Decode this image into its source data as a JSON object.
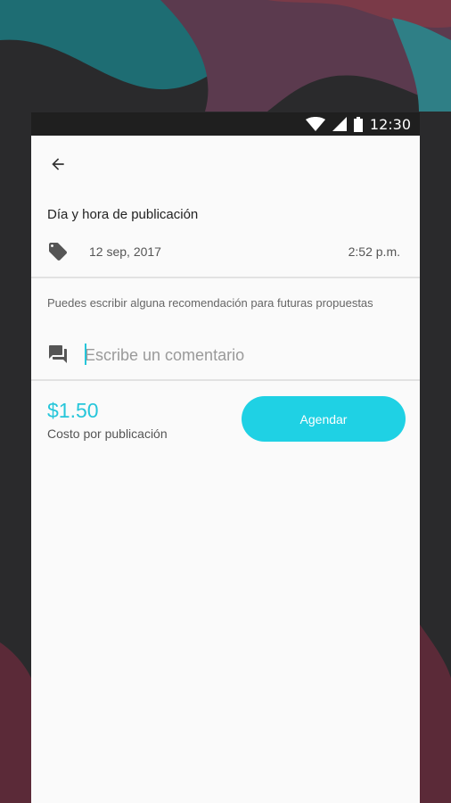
{
  "status_bar": {
    "time": "12:30"
  },
  "app_bar": {
    "back_icon": "arrow-left-icon",
    "title": ""
  },
  "schedule": {
    "title": "Día y hora de publicación",
    "date_icon": "tag-icon",
    "date": "12 sep, 2017",
    "time": "2:52 p.m."
  },
  "comment": {
    "hint": "Puedes escribir alguna recomendación para futuras propuestas",
    "icon": "chat-icon",
    "placeholder": "Escribe un comentario",
    "value": ""
  },
  "footer": {
    "price": "$1.50",
    "price_label": "Costo por publicación",
    "button_label": "Agendar"
  },
  "colors": {
    "accent": "#26c6da",
    "button": "#1fd1e4",
    "background": "#fafafa"
  }
}
